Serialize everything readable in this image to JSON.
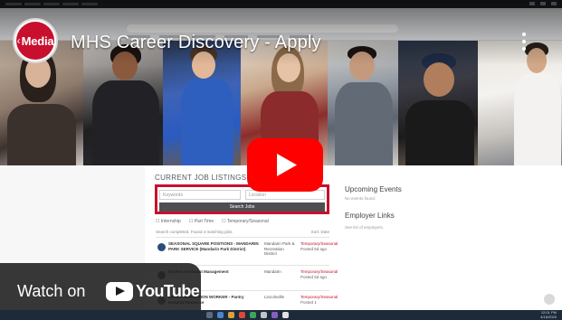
{
  "video": {
    "title": "MHS Career Discovery - Apply",
    "channel_logo_text": "Media",
    "watch_on_label": "Watch on",
    "youtube_wordmark": "YouTube"
  },
  "page": {
    "section_title": "CURRENT JOB LISTINGS",
    "search": {
      "keyword_placeholder": "Keywords",
      "location_placeholder": "Location",
      "button_label": "Search Jobs"
    },
    "filters": [
      "Internship",
      "Part Time",
      "Temporary/Seasonal"
    ],
    "results_text": "Search completed. Found 4 matching jobs.",
    "sort_label": "Sort: Date",
    "jobs": [
      {
        "title": "SEASONAL SQUARE POSITIONS - MANDARIN PARK SERVICE (Mandarin Park District)",
        "location": "Mandarin Park & Recreation District",
        "type": "Temporary/Seasonal",
        "type_sub": "Posted 5d ago"
      },
      {
        "title": "Kitchen Assistant Management",
        "location": "Mandarin",
        "type": "Temporary/Seasonal",
        "type_sub": "Posted 6d ago"
      },
      {
        "title": "LEAD PRODUCTION WORKER - Pantry Hospital Resource",
        "location": "Lincolnville",
        "type": "Temporary/Seasonal",
        "type_sub": "Posted 1"
      }
    ],
    "right": {
      "upcoming_title": "Upcoming Events",
      "upcoming_text": "No events found.",
      "employer_title": "Employer Links",
      "employer_text": "See list of employers."
    }
  },
  "taskbar": {
    "time": "12:01 PM",
    "date": "4/16/2020"
  },
  "colors": {
    "brand_red": "#c8102e",
    "youtube_red": "#ff0000",
    "overlay_dark": "#1c1c1c"
  },
  "icons": [
    "channel-logo",
    "more-vert-icon",
    "play-icon",
    "youtube-logo-icon"
  ]
}
